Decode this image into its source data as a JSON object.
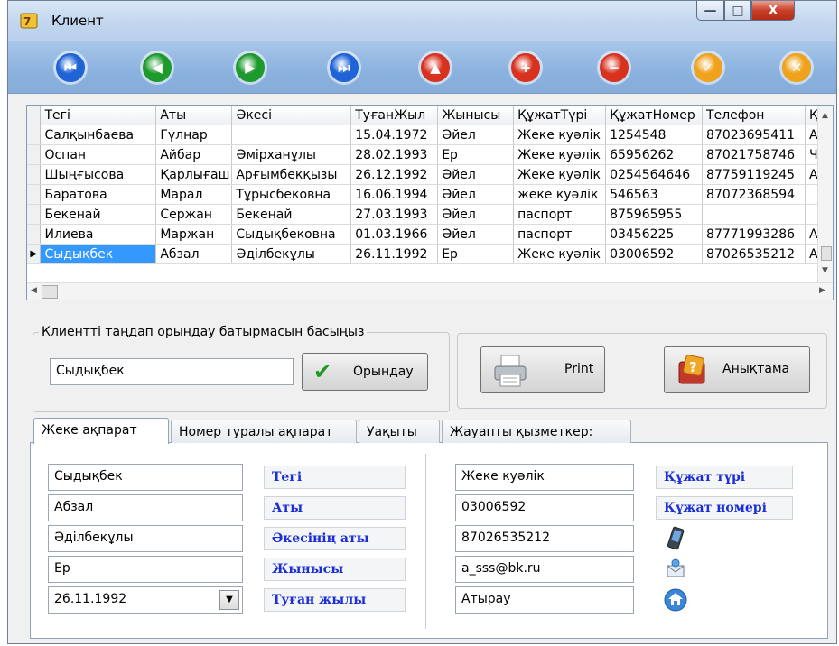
{
  "window": {
    "title": "Клиент",
    "controls": {
      "minimize": "—",
      "maximize": "□",
      "close": "X"
    }
  },
  "toolbar": {
    "buttons": [
      {
        "name": "first",
        "icon": "first-record-icon",
        "color": "#1f63d6"
      },
      {
        "name": "previous",
        "icon": "previous-record-icon",
        "color": "#1d9a2c"
      },
      {
        "name": "next",
        "icon": "next-record-icon",
        "color": "#1d9a2c"
      },
      {
        "name": "last",
        "icon": "last-record-icon",
        "color": "#1f63d6"
      },
      {
        "name": "up",
        "icon": "up-arrow-icon",
        "color": "#d8321f"
      },
      {
        "name": "add",
        "icon": "add-icon",
        "color": "#d8321f"
      },
      {
        "name": "delete",
        "icon": "minus-icon",
        "color": "#d8321f"
      },
      {
        "name": "apply",
        "icon": "check-icon",
        "color": "#f0a21c"
      },
      {
        "name": "cancel",
        "icon": "cancel-icon",
        "color": "#f0a21c"
      }
    ]
  },
  "grid": {
    "columns": [
      "Тегі",
      "Аты",
      "Әкесі",
      "ТуғанЖыл",
      "Жынысы",
      "ҚұжатТүрі",
      "ҚұжатНомер",
      "Телефон",
      "Қ"
    ],
    "rows": [
      [
        "Салқынбаева",
        "Гүлнар",
        "",
        "15.04.1972",
        "Әйел",
        "Жеке куәлік",
        "1254548",
        "87023695411",
        "А"
      ],
      [
        "Оспан",
        "Айбар",
        "Әмірханұлы",
        "28.02.1993",
        "Ер",
        "Жеке куәлік",
        "65956262",
        "87021758746",
        "Ч"
      ],
      [
        "Шыңғысова",
        "Қарлығаш",
        "Арғымбекқызы",
        "26.12.1992",
        "Әйел",
        "Жеке куәлік",
        "0254564646",
        "87759119245",
        "А"
      ],
      [
        "Баратова",
        "Марал",
        "Тұрысбековна",
        "16.06.1994",
        "Әйел",
        "жеке куәлік",
        "546563",
        "87072368594",
        ""
      ],
      [
        "Бекенай",
        "Сержан",
        "Бекенай",
        "27.03.1993",
        "Әйел",
        "паспорт",
        "875965955",
        "",
        ""
      ],
      [
        "Илиева",
        "Маржан",
        "Сыдықбековна",
        "01.03.1966",
        "Әйел",
        "паспорт",
        "03456225",
        "87771993286",
        "А"
      ],
      [
        "Сыдықбек",
        "Абзал",
        "Әділбекұлы",
        "26.11.1992",
        "Ер",
        "Жеке куәлік",
        "03006592",
        "87026535212",
        "А"
      ]
    ],
    "selected_row": 6
  },
  "select_group": {
    "legend": "Клиентті таңдап орындау батырмасын басыңыз",
    "input_value": "Сыдықбек",
    "execute_label": "Орындау"
  },
  "actions": {
    "print_label": "Print",
    "help_label": "Анықтама"
  },
  "tabs": [
    {
      "label": "Жеке ақпарат",
      "active": true
    },
    {
      "label": "Номер туралы ақпарат",
      "active": false
    },
    {
      "label": "Уақыты",
      "active": false
    },
    {
      "label": "Жауапты қызметкер:",
      "active": false
    }
  ],
  "details": {
    "left": [
      {
        "value": "Сыдықбек",
        "label": "Тегі"
      },
      {
        "value": "Абзал",
        "label": "Аты"
      },
      {
        "value": "Әділбекұлы",
        "label": "Әкесінің аты"
      },
      {
        "value": "Ер",
        "label": "Жынысы"
      },
      {
        "value": "26.11.1992",
        "label": "Туған жылы"
      }
    ],
    "right": [
      {
        "value": "Жеке куәлік",
        "label": "Құжат түрі"
      },
      {
        "value": "03006592",
        "label": "Құжат номері"
      },
      {
        "value": "87026535212",
        "icon": "phone-icon"
      },
      {
        "value": "a_sss@bk.ru",
        "icon": "email-icon"
      },
      {
        "value": "Атырау",
        "icon": "home-icon"
      }
    ]
  }
}
